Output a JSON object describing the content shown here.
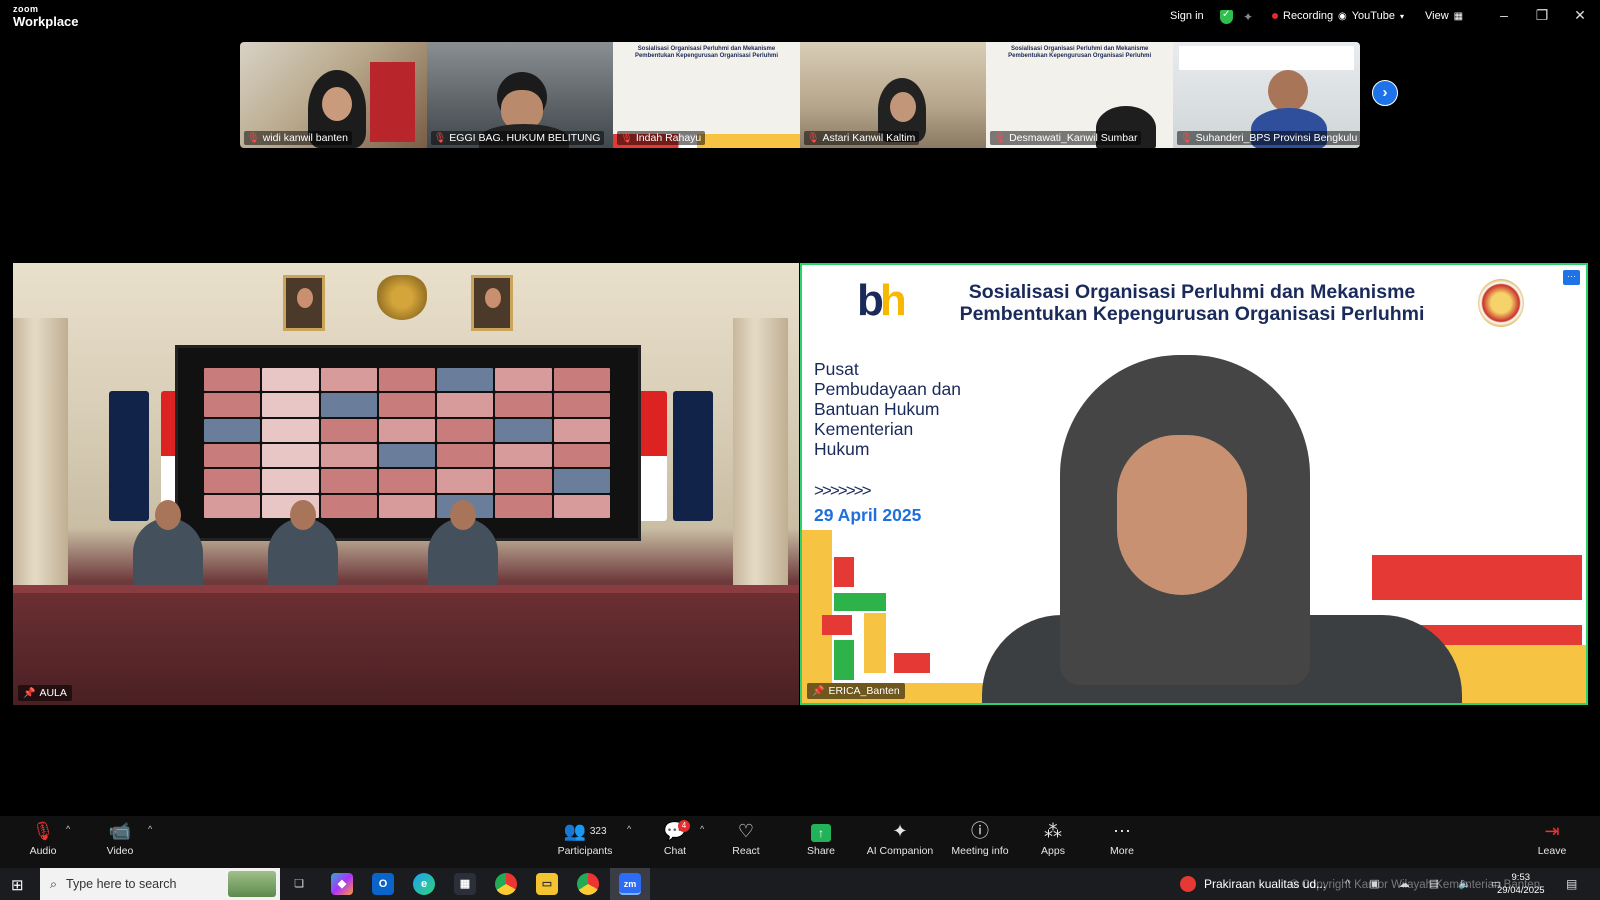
{
  "app": {
    "logo_line1": "zoom",
    "logo_line2": "Workplace"
  },
  "topbar": {
    "sign_in": "Sign in",
    "recording": "Recording",
    "stream": "YouTube",
    "view": "View"
  },
  "strip": {
    "tiles": [
      {
        "name": "widi kanwil banten"
      },
      {
        "name": "EGGI BAG. HUKUM BELITUNG"
      },
      {
        "name": "Indah Rahayu"
      },
      {
        "name": "Astari Kanwil Kaltim"
      },
      {
        "name": "Desmawati_Kanwil Sumbar"
      },
      {
        "name": "Suhanderi_BPS Provinsi Bengkulu"
      }
    ]
  },
  "main": {
    "left_label": "AULA",
    "right_label": "ERICA_Banten",
    "slide": {
      "title_line1": "Sosialisasi Organisasi  Perluhmi dan Mekanisme",
      "title_line2": "Pembentukan Kepengurusan Organisasi Perluhmi",
      "body": "Pusat Pembudayaan dan Bantuan Hukum Kementerian Hukum",
      "chevrons": ">>>>>>>",
      "date": "29 April 2025"
    }
  },
  "toolbar": {
    "audio": "Audio",
    "video": "Video",
    "participants": "Participants",
    "participant_count": "323",
    "chat": "Chat",
    "chat_badge": "4",
    "react": "React",
    "share": "Share",
    "ai_companion": "AI Companion",
    "meeting_info": "Meeting info",
    "apps": "Apps",
    "more": "More",
    "leave": "Leave"
  },
  "taskbar": {
    "search_placeholder": "Type here to search",
    "weather": "Prakiraan kualitas ud...",
    "time": "9:53",
    "date": "29/04/2025",
    "watermark": "© Copyright Kantor Wilayah Kementerian Banten"
  },
  "colors": {
    "active_speaker": "#2bd46a",
    "accent": "#1f73e8",
    "recording": "#e32c2c",
    "share": "#22b35a"
  }
}
